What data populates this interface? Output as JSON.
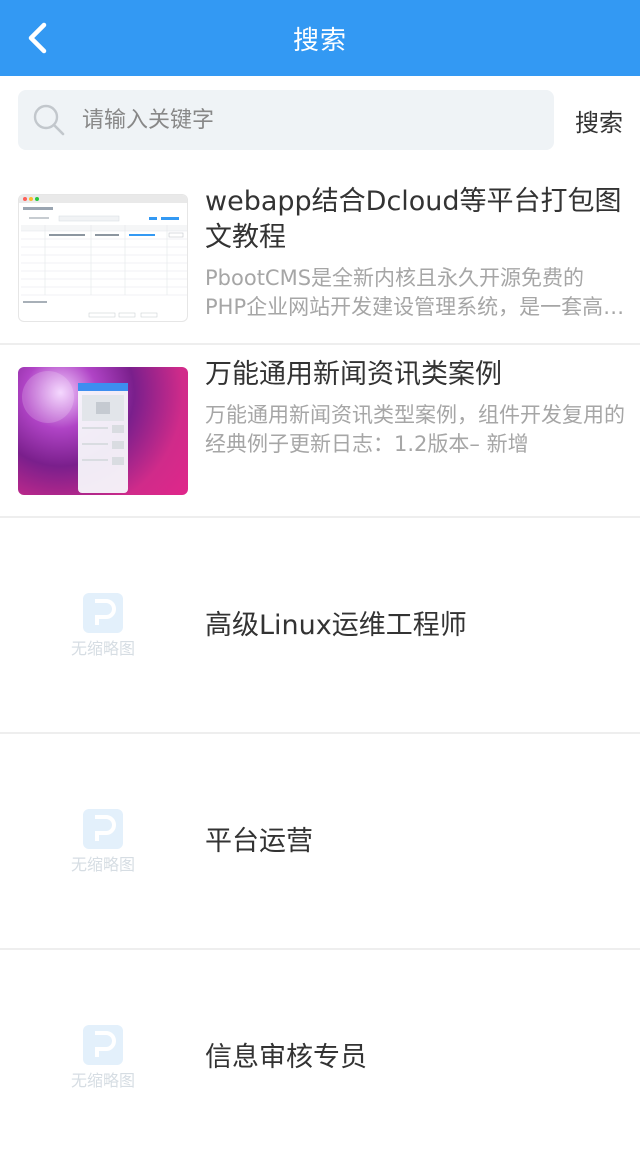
{
  "header": {
    "title": "搜索",
    "back_icon": "chevron-left-icon"
  },
  "search": {
    "placeholder": "请输入关键字",
    "value": "",
    "submit_label": "搜索",
    "icon": "search-icon"
  },
  "colors": {
    "header_bg": "#3399f3",
    "search_bg": "#eff3f6",
    "title_text": "#333333",
    "desc_text": "#a6a6a6",
    "divider": "#eeeeee"
  },
  "results": [
    {
      "title": "webapp结合Dcloud等平台打包图文教程",
      "desc": "PbootCMS是全新内核且永久开源免费的PHP企业网站开发建设管理系统，是一套高效、简洁、强悍的可免费商用的PHP CMS源码",
      "thumb": "screenshot"
    },
    {
      "title": "万能通用新闻资讯类案例",
      "desc": "万能通用新闻资讯类型案例，组件开发复用的经典例子更新日志：1.2版本– 新增",
      "thumb": "purple-app"
    },
    {
      "title": "高级Linux运维工程师",
      "desc": "",
      "thumb": "placeholder"
    },
    {
      "title": "平台运营",
      "desc": "",
      "thumb": "placeholder"
    },
    {
      "title": "信息审核专员",
      "desc": "",
      "thumb": "placeholder"
    }
  ],
  "placeholder_thumb_label": "无缩略图"
}
